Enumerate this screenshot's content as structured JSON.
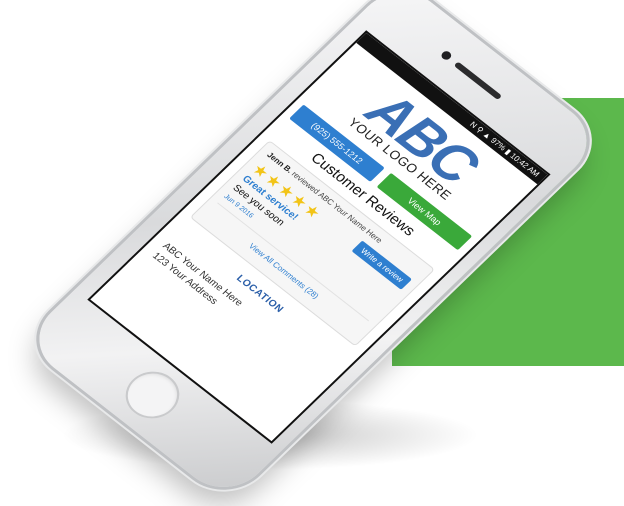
{
  "status_bar": {
    "text": "N ⚲ ▲ 97% ▮ 10:42 AM"
  },
  "logo": {
    "letters": "ABC",
    "tagline": "YOUR LOGO HERE"
  },
  "buttons": {
    "phone": "(925) 555-1212",
    "map": "View Map"
  },
  "reviews": {
    "title": "Customer Reviews",
    "write_label": "Write a review",
    "item": {
      "author": "Jenn B.",
      "action": "reviewed ABC Your Name Here",
      "stars": "★★★★★",
      "headline": "Great service!",
      "body": "See you soon",
      "date": "Jun 9 2016"
    },
    "view_all_label": "View All Comments (28)"
  },
  "location": {
    "title": "LOCATION",
    "name": "ABC Your Name Here",
    "address": "123 Your Address"
  },
  "colors": {
    "background_green": "#5cb84c",
    "brand_blue": "#3a6fb5",
    "button_blue": "#2e7fd0",
    "button_green": "#3aa93a",
    "star_yellow": "#f2c417"
  }
}
